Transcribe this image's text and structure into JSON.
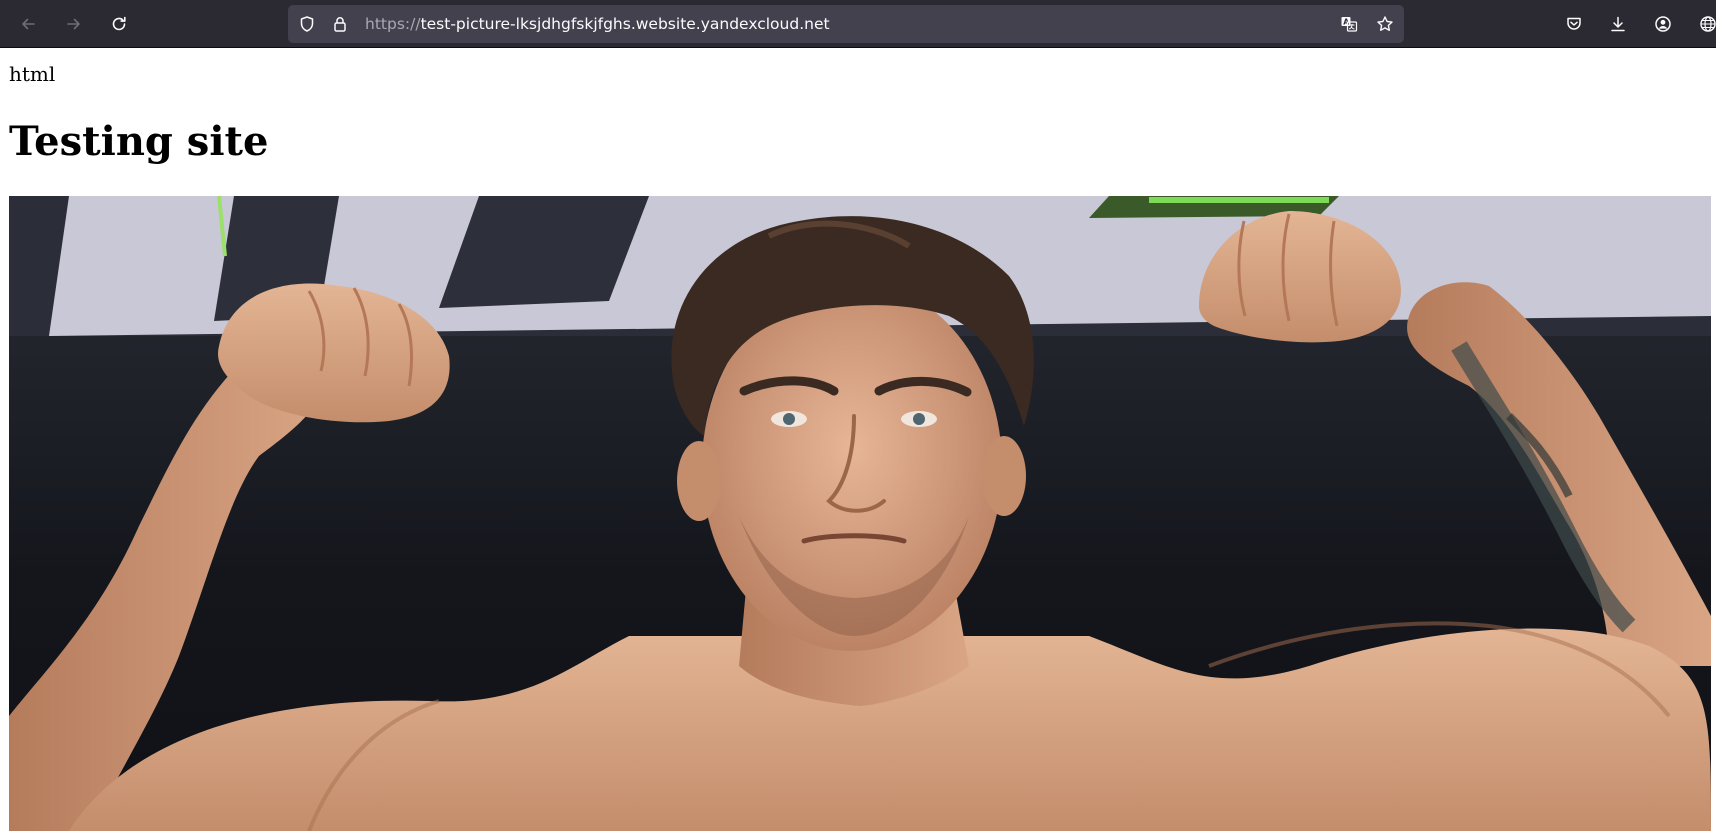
{
  "browser": {
    "url_scheme": "https://",
    "url_host": "test-picture-lksjdhgfskjfghs.website.yandexcloud.net",
    "toolbar_icons": [
      "back-arrow-icon",
      "forward-arrow-icon",
      "reload-icon",
      "shield-icon",
      "lock-icon",
      "translate-icon",
      "bookmark-star-icon",
      "pocket-icon",
      "download-icon",
      "account-icon",
      "globe-icon"
    ]
  },
  "page": {
    "label": "html",
    "heading": "Testing site",
    "image": {
      "subject": "man-flexing-arms-photo"
    }
  },
  "colors": {
    "toolbar_bg": "#2b2a33",
    "urlbar_bg": "#42414d",
    "page_bg": "#ffffff"
  }
}
